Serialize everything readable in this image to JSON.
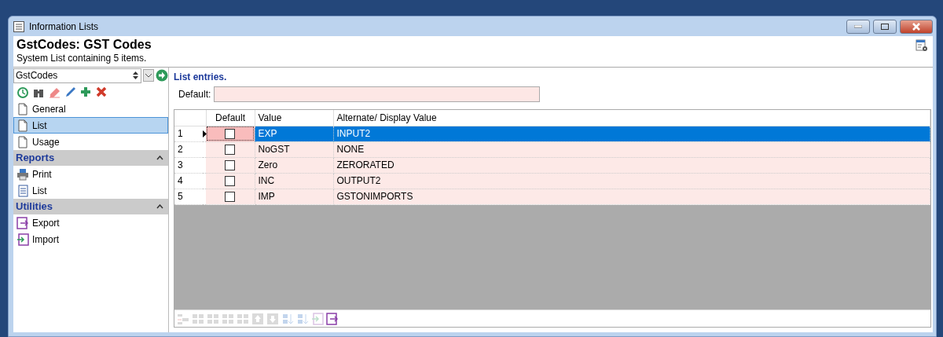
{
  "window": {
    "title": "Information Lists"
  },
  "header": {
    "title": "GstCodes: GST Codes",
    "subtitle": "System List containing 5 items."
  },
  "sidebar": {
    "selector": {
      "value": "GstCodes"
    },
    "tools": [
      {
        "kind": "history"
      },
      {
        "kind": "find"
      },
      {
        "kind": "erase"
      },
      {
        "kind": "edit"
      },
      {
        "kind": "add"
      },
      {
        "kind": "delete"
      }
    ],
    "items": [
      {
        "label": "General",
        "selected": false
      },
      {
        "label": "List",
        "selected": true
      },
      {
        "label": "Usage",
        "selected": false
      }
    ],
    "sections": [
      {
        "title": "Reports",
        "expanded": true,
        "items": [
          {
            "label": "Print",
            "kind": "print"
          },
          {
            "label": "List",
            "kind": "list"
          }
        ]
      },
      {
        "title": "Utilities",
        "expanded": true,
        "items": [
          {
            "label": "Export",
            "kind": "export"
          },
          {
            "label": "Import",
            "kind": "import"
          }
        ]
      }
    ]
  },
  "panel": {
    "heading": "List entries.",
    "default_label": "Default:"
  },
  "table": {
    "columns": [
      "Default",
      "Value",
      "Alternate/ Display Value"
    ],
    "rows": [
      {
        "number": "1",
        "current": true,
        "selected": true,
        "checked": false,
        "value": "EXP",
        "alternate": "INPUT2"
      },
      {
        "number": "2",
        "current": false,
        "selected": false,
        "checked": false,
        "value": "NoGST",
        "alternate": "NONE"
      },
      {
        "number": "3",
        "current": false,
        "selected": false,
        "checked": false,
        "value": "Zero",
        "alternate": "ZERORATED"
      },
      {
        "number": "4",
        "current": false,
        "selected": false,
        "checked": false,
        "value": "INC",
        "alternate": "OUTPUT2"
      },
      {
        "number": "5",
        "current": false,
        "selected": false,
        "checked": false,
        "value": "IMP",
        "alternate": "GSTONIMPORTS"
      }
    ]
  },
  "grid_toolbar": [
    {
      "kind": "indent",
      "disabled": true
    },
    {
      "kind": "grid",
      "disabled": true
    },
    {
      "kind": "grid",
      "disabled": true
    },
    {
      "kind": "grid",
      "disabled": true
    },
    {
      "kind": "grid",
      "disabled": true
    },
    {
      "kind": "up",
      "disabled": true
    },
    {
      "kind": "down",
      "disabled": true
    },
    {
      "kind": "sort-asc",
      "disabled": true
    },
    {
      "kind": "sort-desc",
      "disabled": true
    },
    {
      "kind": "import",
      "disabled": true
    },
    {
      "kind": "export",
      "disabled": false
    }
  ]
}
